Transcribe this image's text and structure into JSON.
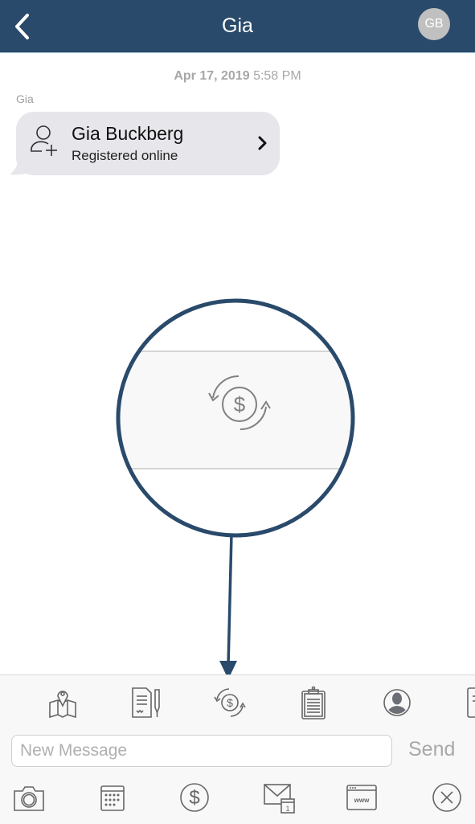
{
  "navbar": {
    "back_icon": "chevron-left-icon",
    "title": "Gia",
    "avatar_initials": "GB",
    "bg_color": "#2a4a6b"
  },
  "conversation": {
    "timestamp_date": "Apr 17, 2019",
    "timestamp_time": "5:58 PM",
    "sender_label": "Gia",
    "card": {
      "icon": "user-add-icon",
      "name": "Gia Buckberg",
      "subtitle": "Registered online",
      "chevron": "chevron-right-icon"
    }
  },
  "callout": {
    "magnified_icon": "money-exchange-icon",
    "annotation_color": "#2a4a6b"
  },
  "toolbar": {
    "top_icons": [
      "map-pin-icon",
      "document-sign-icon",
      "money-exchange-icon",
      "clipboard-icon",
      "contact-avatar-icon",
      "document-icon"
    ],
    "input_placeholder": "New Message",
    "input_value": "",
    "send_label": "Send",
    "bottom_icons": [
      "camera-icon",
      "calendar-icon",
      "dollar-icon",
      "mail-calendar-icon",
      "web-browser-icon",
      "close-circle-icon"
    ]
  }
}
